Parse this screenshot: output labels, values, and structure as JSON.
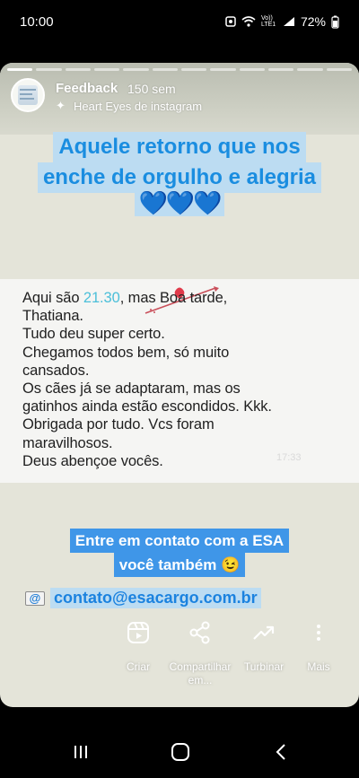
{
  "status_bar": {
    "time": "10:00",
    "network": "Vo)) LTE1",
    "battery": "72%"
  },
  "story": {
    "account_name": "Feedback",
    "post_age": "150 sem",
    "sticker_source": "Heart Eyes de instagram",
    "headline_lines": [
      "Aquele retorno que nos",
      "enche de orgulho e alegria"
    ],
    "hearts": "💙💙💙",
    "message": {
      "line1_pre": "Aqui são ",
      "line1_time": "21.30",
      "line1_post": ", mas Boa tarde,",
      "lines": [
        "Thatiana.",
        "Tudo deu super certo.",
        "Chegamos todos bem, só muito",
        "cansados.",
        "Os cães já se adaptaram, mas os",
        "gatinhos ainda estão escondidos. Kkk.",
        "Obrigada por tudo. Vcs foram",
        "maravilhosos.",
        "Deus abençoe vocês."
      ],
      "timestamp": "17:33"
    },
    "cta_lines": [
      "Entre em contato com a ESA",
      "você também 😉"
    ],
    "email": "contato@esacargo.com.br"
  },
  "actions": {
    "criar": "Criar",
    "compartilhar": "Compartilhar em...",
    "turbinar": "Turbinar",
    "mais": "Mais"
  },
  "colors": {
    "headline_blue": "#1a8de0",
    "highlight_bg": "#bcdcf2",
    "cta_bg": "#3f96e8"
  }
}
